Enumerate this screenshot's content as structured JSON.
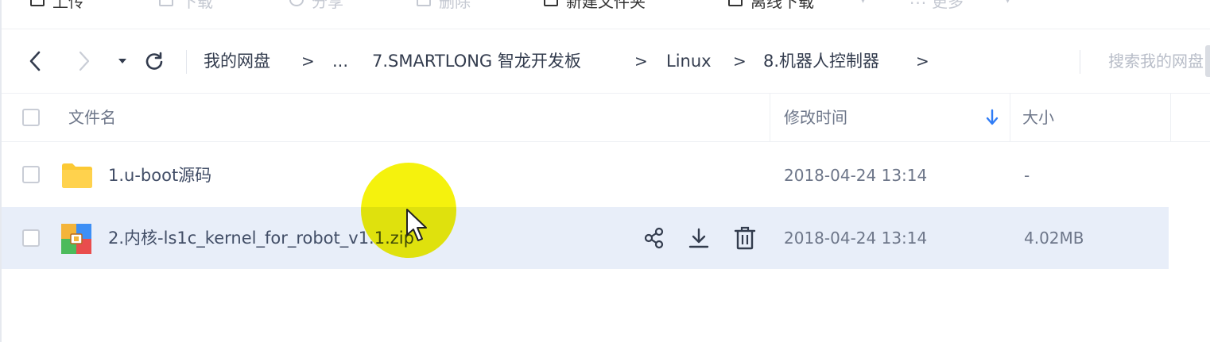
{
  "toolbar": {
    "items": [
      {
        "label": "上传"
      },
      {
        "label": "下载"
      },
      {
        "label": "分享"
      },
      {
        "label": "删除"
      },
      {
        "label": "新建文件夹"
      },
      {
        "label": "离线下载"
      },
      {
        "label": "更多"
      }
    ]
  },
  "nav": {
    "back_icon": "chevron-left-icon",
    "forward_icon": "chevron-right-icon",
    "history_icon": "caret-down-icon",
    "refresh_icon": "refresh-icon",
    "breadcrumb": [
      {
        "label": "我的网盘"
      },
      {
        "label": "..."
      },
      {
        "label": "7.SMARTLONG 智龙开发板"
      },
      {
        "label": "Linux"
      },
      {
        "label": "8.机器人控制器"
      }
    ],
    "separator": ">",
    "search_placeholder": "搜索我的网盘"
  },
  "table": {
    "headers": {
      "name": "文件名",
      "modified": "修改时间",
      "size": "大小"
    },
    "sort_icon": "sort-down-arrow-icon",
    "rows": [
      {
        "icon": "folder-icon",
        "name": "1.u-boot源码",
        "modified": "2018-04-24 13:14",
        "size": "-",
        "selected": false
      },
      {
        "icon": "zip-archive-icon",
        "name": "2.内核-ls1c_kernel_for_robot_v1.1.zip",
        "modified": "2018-04-24 13:14",
        "size": "4.02MB",
        "selected": true,
        "actions": [
          "share-icon",
          "download-icon",
          "delete-icon"
        ]
      }
    ]
  },
  "colors": {
    "accent": "#2f7cf6",
    "selected_row": "#e8eef9",
    "folder": "#fcc934",
    "cursor_highlight": "#f5f200"
  }
}
